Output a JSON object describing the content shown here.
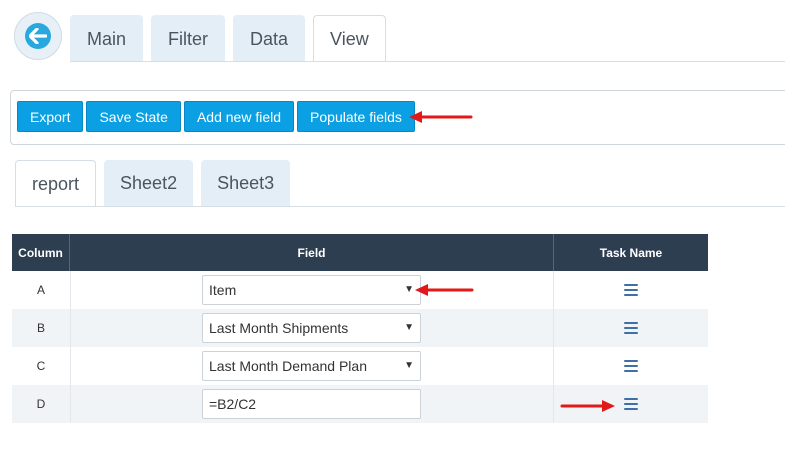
{
  "top_tabs": [
    {
      "label": "Main",
      "active": false
    },
    {
      "label": "Filter",
      "active": false
    },
    {
      "label": "Data",
      "active": false
    },
    {
      "label": "View",
      "active": true
    }
  ],
  "toolbar": {
    "export_label": "Export",
    "save_state_label": "Save State",
    "add_field_label": "Add new field",
    "populate_fields_label": "Populate fields"
  },
  "sheet_tabs": [
    {
      "label": "report",
      "active": true
    },
    {
      "label": "Sheet2",
      "active": false
    },
    {
      "label": "Sheet3",
      "active": false
    }
  ],
  "grid": {
    "headers": {
      "column": "Column",
      "field": "Field",
      "task_name": "Task Name"
    },
    "rows": [
      {
        "column": "A",
        "field": "Item",
        "type": "select"
      },
      {
        "column": "B",
        "field": "Last Month Shipments",
        "type": "select"
      },
      {
        "column": "C",
        "field": "Last Month Demand Plan",
        "type": "select"
      },
      {
        "column": "D",
        "field": "=B2/C2",
        "type": "input"
      }
    ]
  },
  "icons": {
    "back": "arrow-left-icon",
    "task": "hamburger-menu-icon",
    "annotation": "red-arrow"
  },
  "colors": {
    "accent": "#0aa0e3",
    "header_bg": "#2d3e50",
    "tab_bg": "#e4eef6",
    "annotation": "#e11919",
    "menu_icon": "#3f6fa6"
  }
}
